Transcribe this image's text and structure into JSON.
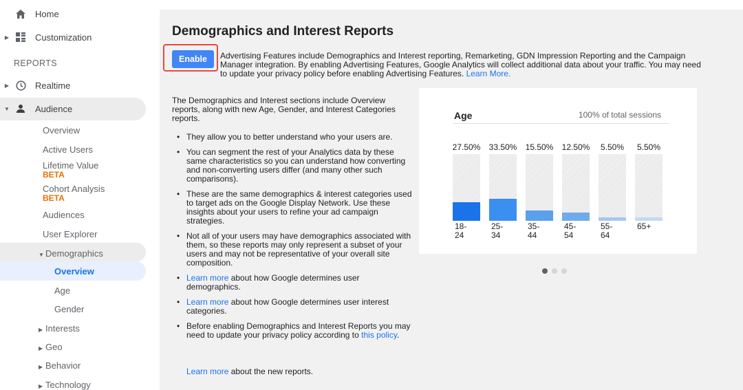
{
  "sidebar": {
    "home": "Home",
    "customization": "Customization",
    "reports_heading": "REPORTS",
    "realtime": "Realtime",
    "audience": "Audience",
    "audience_items": {
      "overview": "Overview",
      "active_users": "Active Users",
      "lifetime_value": "Lifetime Value",
      "lifetime_value_badge": "BETA",
      "cohort_analysis": "Cohort Analysis",
      "cohort_analysis_badge": "BETA",
      "audiences": "Audiences",
      "user_explorer": "User Explorer",
      "demographics": "Demographics",
      "demographics_items": [
        "Overview",
        "Age",
        "Gender"
      ],
      "interests": "Interests",
      "geo": "Geo",
      "behavior": "Behavior",
      "technology": "Technology"
    }
  },
  "main": {
    "title": "Demographics and Interest Reports",
    "enable_label": "Enable",
    "advertising_text": "Advertising Features include Demographics and Interest reporting, Remarketing, GDN Impression Reporting and the Campaign Manager integration. By enabling Advertising Features, Google Analytics will collect additional data about your traffic. You may need to update your privacy policy before enabling Advertising Features.",
    "advertising_link": "Learn More.",
    "intro": "The Demographics and Interest sections include Overview reports, along with new Age, Gender, and Interest Categories reports.",
    "bullets": [
      "They allow you to better understand who your users are.",
      "You can segment the rest of your Analytics data by these same characteristics so you can understand how converting and non-converting users differ (and many other such comparisons).",
      "These are the same demographics & interest categories used to target ads on the Google Display Network. Use these insights about your users to refine your ad campaign strategies.",
      "Not all of your users may have demographics associated with them, so these reports may only represent a subset of your users and may not be representative of your overall site composition."
    ],
    "link_bullets": [
      {
        "link": "Learn more",
        "text": " about how Google determines user demographics."
      },
      {
        "link": "Learn more",
        "text": " about how Google determines user interest categories."
      }
    ],
    "privacy_bullet": {
      "text": "Before enabling Demographics and Interest Reports you may need to update your privacy policy according to ",
      "link": "this policy",
      "end": "."
    },
    "footer": {
      "link": "Learn more",
      "text": " about the new reports."
    }
  },
  "chart_data": {
    "type": "bar",
    "title": "Age",
    "subtitle": "100% of total sessions",
    "categories": [
      "18-24",
      "25-34",
      "35-44",
      "45-54",
      "55-64",
      "65+"
    ],
    "category_lines": [
      [
        "18-",
        "24"
      ],
      [
        "25-",
        "34"
      ],
      [
        "35-",
        "44"
      ],
      [
        "45-",
        "54"
      ],
      [
        "55-",
        "64"
      ],
      [
        "65+"
      ]
    ],
    "values": [
      27.5,
      33.5,
      15.5,
      12.5,
      5.5,
      5.5
    ],
    "value_labels": [
      "27.50%",
      "33.50%",
      "15.50%",
      "12.50%",
      "5.50%",
      "5.50%"
    ],
    "ylim": [
      0,
      100
    ],
    "colors": [
      "#1a73e8",
      "#3b8ff0",
      "#5aa0ea",
      "#6fabea",
      "#a7c7ee",
      "#c4d9f2"
    ],
    "grid": false,
    "legend": "none"
  },
  "carousel": {
    "pages": 3,
    "current": 1
  }
}
